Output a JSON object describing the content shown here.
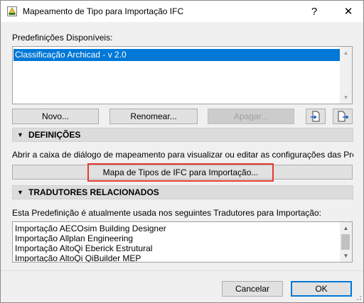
{
  "window": {
    "title": "Mapeamento de Tipo para Importação IFC",
    "help_glyph": "?",
    "close_glyph": "✕"
  },
  "presets": {
    "label": "Predefinições Disponíveis:",
    "items": [
      "Classificação Archicad - v 2.0"
    ],
    "selected_index": 0
  },
  "preset_buttons": {
    "new": "Novo...",
    "rename": "Renomear...",
    "delete": "Apagar...",
    "import_icon": "import-icon",
    "export_icon": "export-icon"
  },
  "definitions": {
    "header": "DEFINIÇÕES",
    "description": "Abrir a caixa de diálogo de mapeamento para visualizar ou editar as configurações das Predef",
    "map_button": "Mapa de Tipos de IFC para Importação..."
  },
  "translators": {
    "header": "TRADUTORES RELACIONADOS",
    "description": "Esta Predefinição é atualmente usada nos seguintes Tradutores para Importação:",
    "items": [
      "Importação AECOsim Building Designer",
      "Importação Allplan Engineering",
      "Importação AltoQi Eberick Estrutural",
      "Importação AltoQi QiBuilder MEP"
    ]
  },
  "footer": {
    "cancel": "Cancelar",
    "ok": "OK"
  },
  "colors": {
    "selection": "#0078d7",
    "highlight_border": "#e53935",
    "section_bar": "#dcdcdc"
  }
}
